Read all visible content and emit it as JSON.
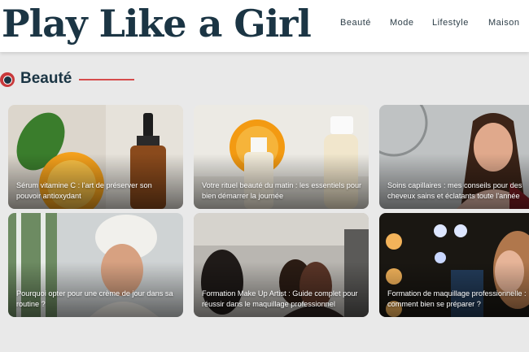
{
  "header": {
    "logo": "Play Like a Girl",
    "nav": [
      "Beauté",
      "Mode",
      "Lifestyle",
      "Maison"
    ]
  },
  "section": {
    "title": "Beauté",
    "accent_color": "#d64b4b",
    "icon": "category-badge-icon"
  },
  "articles": [
    {
      "title": "Sérum vitamine C : l'art de préserver son pouvoir antioxydant"
    },
    {
      "title": "Votre rituel beauté du matin : les essentiels pour bien démarrer la journée"
    },
    {
      "title": "Soins capillaires : mes conseils pour des cheveux sains et éclatants toute l'année"
    },
    {
      "title": "Pourquoi opter pour une crème de jour dans sa routine ?"
    },
    {
      "title": "Formation Make Up Artist : Guide complet pour réussir dans le maquillage professionnel"
    },
    {
      "title": "Formation de maquillage professionnelle : comment bien se préparer ?"
    }
  ],
  "colors": {
    "brand": "#1b3544",
    "background": "#e9e9e9"
  }
}
